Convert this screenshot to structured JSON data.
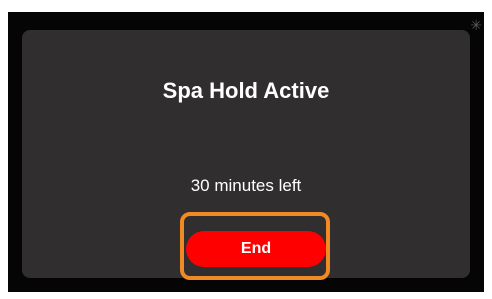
{
  "dialog": {
    "title": "Spa Hold Active",
    "message": "30 minutes left",
    "end_button_label": "End"
  },
  "colors": {
    "screen_background": "#050505",
    "dialog_background": "#302e2f",
    "button_background": "#ff0000",
    "highlight_outline": "#f08a24",
    "text": "#ffffff"
  }
}
